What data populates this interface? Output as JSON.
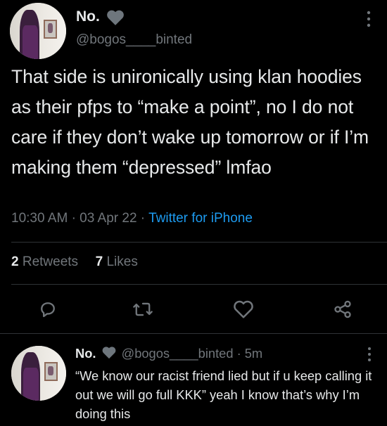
{
  "tweet": {
    "display_name": "No.",
    "handle": "@bogos____binted",
    "text": "That side is unironically using klan hoodies as their pfps to “make a point”, no I do not care if they don’t wake up tomorrow or if I’m making them “depressed” lmfao",
    "time": "10:30 AM",
    "date": "03 Apr 22",
    "source": "Twitter for iPhone",
    "retweets_count": "2",
    "retweets_label": "Retweets",
    "likes_count": "7",
    "likes_label": "Likes"
  },
  "reply": {
    "display_name": "No.",
    "handle": "@bogos____binted",
    "age": "5m",
    "text": "“We know our racist friend lied but if u keep calling it out we will go full KKK” yeah I know that’s why I’m doing this"
  },
  "icons": [
    "heart-icon",
    "more-icon",
    "reply-icon",
    "retweet-icon",
    "like-icon",
    "share-icon"
  ],
  "colors": {
    "background": "#000000",
    "text": "#e7e9ea",
    "secondary": "#71767b",
    "link": "#1d9bf0",
    "divider": "#2f3336"
  }
}
